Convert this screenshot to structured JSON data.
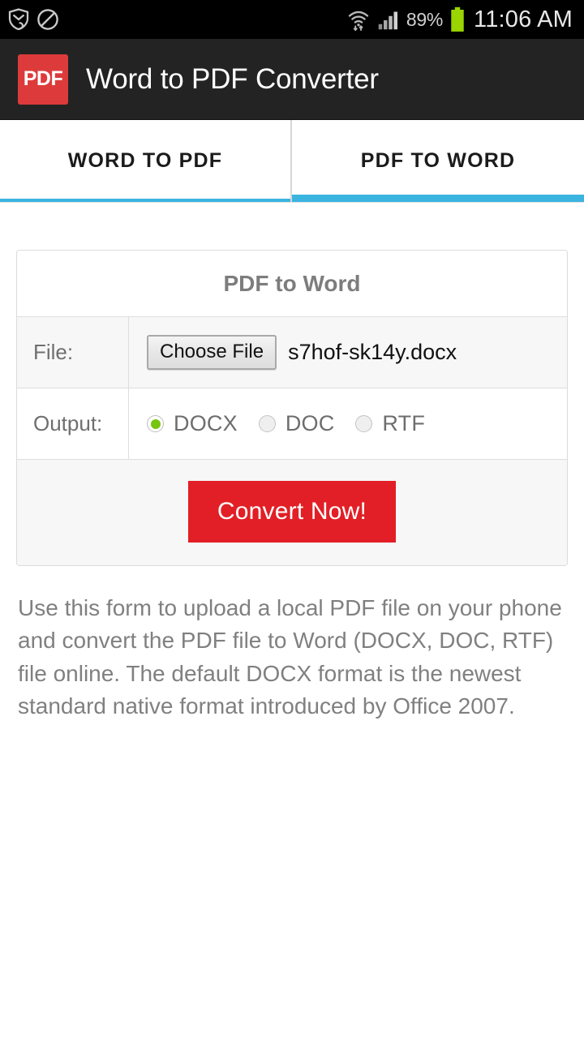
{
  "status_bar": {
    "left_icons": [
      {
        "name": "shield-call-icon",
        "glyph": "shield-phone"
      },
      {
        "name": "block-icon",
        "glyph": "no-entry"
      }
    ],
    "wifi_icon": "wifi-transfer-icon",
    "signal_icon": "cellular-signal-icon",
    "battery_percent": "89%",
    "battery_icon": "battery-full-icon",
    "clock": "11:06 AM",
    "battery_color": "#9ad401",
    "text_color": "#e8e8e8"
  },
  "header": {
    "logo_label": "PDF",
    "logo_color": "#dd3b3b",
    "title": "Word to PDF Converter",
    "background": "#232323"
  },
  "tabs": {
    "accent_color": "#3bb4e0",
    "items": [
      {
        "label": "WORD TO PDF",
        "active": false
      },
      {
        "label": "PDF TO WORD",
        "active": true
      }
    ]
  },
  "card": {
    "title": "PDF to Word",
    "file_row": {
      "label": "File:",
      "button_label": "Choose File",
      "file_name": "s7hof-sk14y.docx"
    },
    "output_row": {
      "label": "Output:",
      "options": [
        {
          "label": "DOCX",
          "checked": true
        },
        {
          "label": "DOC",
          "checked": false
        },
        {
          "label": "RTF",
          "checked": false
        }
      ],
      "selected_color": "#76c511"
    },
    "submit": {
      "label": "Convert Now!",
      "color": "#e21f26"
    }
  },
  "description": "Use this form to upload a local PDF file on your phone and convert the PDF file to Word (DOCX, DOC, RTF) file online. The default DOCX format is the newest standard native format introduced by Office 2007."
}
